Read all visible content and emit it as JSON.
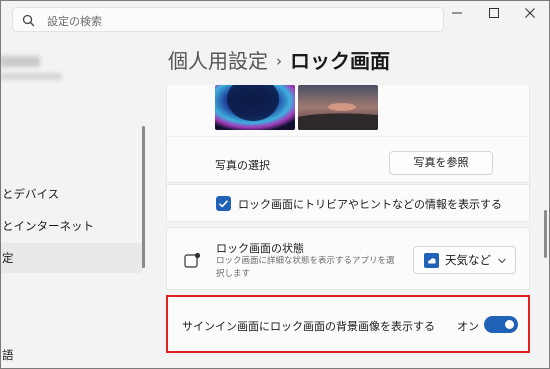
{
  "search": {
    "placeholder": "設定の検索"
  },
  "window": {
    "minimize": "minimize-icon",
    "maximize": "maximize-icon",
    "close": "close-icon"
  },
  "sidebar": {
    "items": [
      {
        "label": "とデバイス"
      },
      {
        "label": "とインターネット"
      },
      {
        "label": "定",
        "selected": true
      },
      {
        "label": "語"
      }
    ]
  },
  "breadcrumb": {
    "parent": "個人用設定",
    "separator": "›",
    "current": "ロック画面"
  },
  "photo_section": {
    "select_label": "写真の選択",
    "browse_button": "写真を参照",
    "trivia_checkbox_label": "ロック画面にトリビアやヒントなどの情報を表示する",
    "trivia_checked": true
  },
  "status_section": {
    "title": "ロック画面の状態",
    "description": "ロック画面に詳細な状態を表示するアプリを選択します",
    "dropdown_value": "天気など"
  },
  "signin_section": {
    "label": "サインイン画面にロック画面の背景画像を表示する",
    "toggle_state": "オン",
    "toggle_on": true
  },
  "colors": {
    "accent": "#1f62b8",
    "highlight": "#e0201c"
  }
}
